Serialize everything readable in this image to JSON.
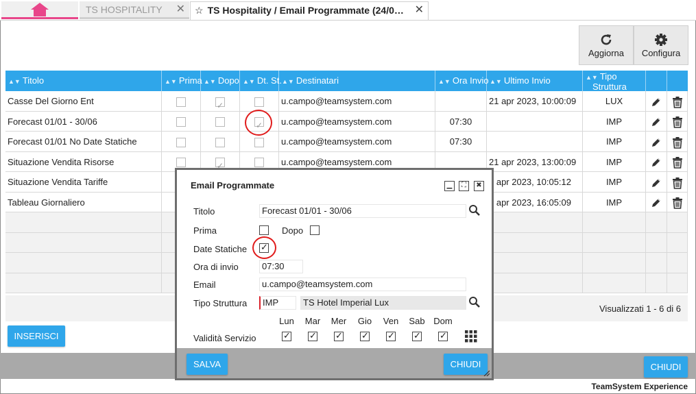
{
  "tabs": {
    "home_icon": "home-icon",
    "hospitality_label": "TS HOSPITALITY",
    "active_label": "TS Hospitality / Email Programmate (24/0…",
    "close_glyph": "✕",
    "star_glyph": "☆"
  },
  "toolbar": {
    "refresh_label": "Aggiorna",
    "configure_label": "Configura"
  },
  "grid": {
    "headers": {
      "titolo": "Titolo",
      "prima": "Prima",
      "dopo": "Dopo",
      "dt_st": "Dt. St.",
      "destinatari": "Destinatari",
      "ora_invio": "Ora Invio",
      "ultimo_invio": "Ultimo Invio",
      "tipo_struttura_1": "Tipo",
      "tipo_struttura_2": "Struttura"
    },
    "rows": [
      {
        "titolo": "Casse Del Giorno Ent",
        "prima": false,
        "dopo": true,
        "dt_st": false,
        "destinatari": "u.campo@teamsystem.com",
        "ora": "",
        "ultimo": "21 apr 2023, 10:00:09",
        "tipo": "LUX"
      },
      {
        "titolo": "Forecast 01/01 - 30/06",
        "prima": false,
        "dopo": false,
        "dt_st": true,
        "destinatari": "u.campo@teamsystem.com",
        "ora": "07:30",
        "ultimo": "",
        "tipo": "IMP"
      },
      {
        "titolo": "Forecast 01/01 No Date Statiche",
        "prima": false,
        "dopo": false,
        "dt_st": false,
        "destinatari": "u.campo@teamsystem.com",
        "ora": "07:30",
        "ultimo": "",
        "tipo": "IMP"
      },
      {
        "titolo": "Situazione Vendita Risorse",
        "prima": false,
        "dopo": true,
        "dt_st": false,
        "destinatari": "u.campo@teamsystem.com",
        "ora": "",
        "ultimo": "21 apr 2023, 13:00:09",
        "tipo": "IMP"
      },
      {
        "titolo": "Situazione Vendita Tariffe",
        "prima": false,
        "dopo": false,
        "dt_st": false,
        "destinatari": "",
        "ora": "",
        "ultimo": "5 apr 2023, 10:05:12",
        "tipo": "IMP"
      },
      {
        "titolo": "Tableau Giornaliero",
        "prima": false,
        "dopo": false,
        "dt_st": false,
        "destinatari": "",
        "ora": "",
        "ultimo": "5 apr 2023, 16:05:09",
        "tipo": "IMP"
      }
    ],
    "footer": "Visualizzati 1 - 6 di 6"
  },
  "buttons": {
    "inserisci": "INSERISCI",
    "chiudi_main": "CHIUDI"
  },
  "brand": "TeamSystem Experience",
  "dialog": {
    "title": "Email Programmate",
    "titolo_label": "Titolo",
    "titolo_value": "Forecast 01/01 - 30/06",
    "prima_label": "Prima",
    "prima_checked": false,
    "dopo_label": "Dopo",
    "dopo_checked": false,
    "date_statiche_label": "Date Statiche",
    "date_statiche_checked": true,
    "ora_label": "Ora di invio",
    "ora_value": "07:30",
    "email_label": "Email",
    "email_value": "u.campo@teamsystem.com",
    "tipo_label": "Tipo Struttura",
    "tipo_code": "IMP",
    "tipo_desc": "TS Hotel Imperial Lux",
    "validita_label": "Validità Servizio",
    "days": [
      "Lun",
      "Mar",
      "Mer",
      "Gio",
      "Ven",
      "Sab",
      "Dom"
    ],
    "days_checked": [
      true,
      true,
      true,
      true,
      true,
      true,
      true
    ],
    "salva": "SALVA",
    "chiudi": "CHIUDI"
  },
  "colors": {
    "accent": "#2fa6ea",
    "home_tab": "#e8468a",
    "highlight_circle": "#e01b1b"
  }
}
